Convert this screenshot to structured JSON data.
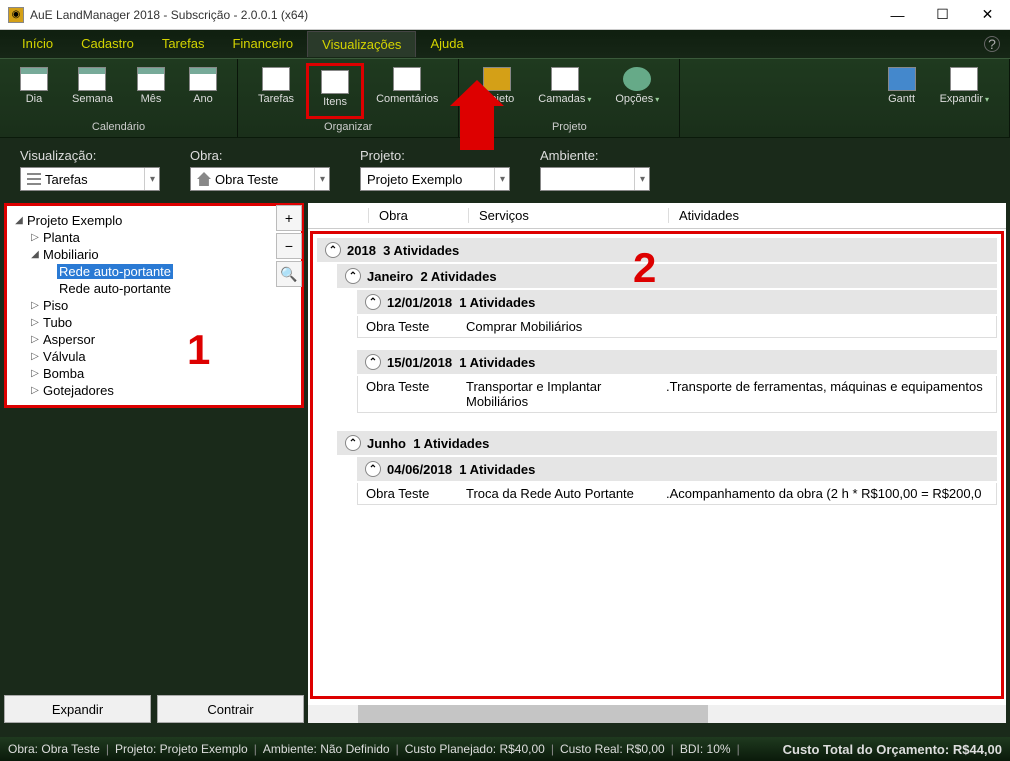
{
  "window": {
    "title": "AuE LandManager 2018  - Subscrição - 2.0.0.1 (x64)"
  },
  "menu": {
    "items": [
      "Início",
      "Cadastro",
      "Tarefas",
      "Financeiro",
      "Visualizações",
      "Ajuda"
    ],
    "active_index": 4
  },
  "ribbon": {
    "groups": [
      {
        "label": "Calendário",
        "buttons": [
          {
            "name": "dia",
            "label": "Dia"
          },
          {
            "name": "semana",
            "label": "Semana"
          },
          {
            "name": "mes",
            "label": "Mês"
          },
          {
            "name": "ano",
            "label": "Ano"
          }
        ]
      },
      {
        "label": "Organizar",
        "buttons": [
          {
            "name": "tarefas",
            "label": "Tarefas"
          },
          {
            "name": "itens",
            "label": "Itens",
            "highlight": true
          },
          {
            "name": "comentarios",
            "label": "Comentários"
          }
        ]
      },
      {
        "label": "Projeto",
        "buttons": [
          {
            "name": "projeto",
            "label": "Projeto"
          },
          {
            "name": "camadas",
            "label": "Camadas",
            "expand": true
          },
          {
            "name": "opcoes",
            "label": "Opções",
            "expand": true
          }
        ]
      },
      {
        "label": "",
        "buttons": [
          {
            "name": "gantt",
            "label": "Gantt"
          },
          {
            "name": "expandir",
            "label": "Expandir",
            "expand": true
          }
        ]
      }
    ]
  },
  "dropdowns": {
    "visualizacao": {
      "label": "Visualização:",
      "value": "Tarefas"
    },
    "obra": {
      "label": "Obra:",
      "value": "Obra Teste"
    },
    "projeto": {
      "label": "Projeto:",
      "value": "Projeto Exemplo"
    },
    "ambiente": {
      "label": "Ambiente:",
      "value": ""
    }
  },
  "tree": {
    "root": "Projeto Exemplo",
    "nodes": [
      {
        "label": "Planta",
        "expanded": false,
        "level": 1
      },
      {
        "label": "Mobiliario",
        "expanded": true,
        "level": 1
      },
      {
        "label": "Rede auto-portante",
        "level": 2,
        "selected": true
      },
      {
        "label": "Rede auto-portante",
        "level": 2
      },
      {
        "label": "Piso",
        "expanded": false,
        "level": 1
      },
      {
        "label": "Tubo",
        "expanded": false,
        "level": 1
      },
      {
        "label": "Aspersor",
        "expanded": false,
        "level": 1
      },
      {
        "label": "Válvula",
        "expanded": false,
        "level": 1
      },
      {
        "label": "Bomba",
        "expanded": false,
        "level": 1
      },
      {
        "label": "Gotejadores",
        "expanded": false,
        "level": 1
      }
    ],
    "annotation": "1",
    "buttons": {
      "expandir": "Expandir",
      "contrair": "Contrair"
    },
    "side": [
      "+",
      "−",
      "🔍"
    ]
  },
  "grid": {
    "headers": [
      "Obra",
      "Serviços",
      "Atividades"
    ],
    "annotation": "2",
    "year": {
      "label": "2018",
      "count": "3 Atividades"
    },
    "months": [
      {
        "label": "Janeiro",
        "count": "2 Atividades",
        "days": [
          {
            "date": "12/01/2018",
            "count": "1 Atividades",
            "rows": [
              {
                "obra": "Obra Teste",
                "servico": "Comprar Mobiliários",
                "atividade": ""
              }
            ]
          },
          {
            "date": "15/01/2018",
            "count": "1 Atividades",
            "rows": [
              {
                "obra": "Obra Teste",
                "servico": "Transportar e Implantar Mobiliários",
                "atividade": ".Transporte de ferramentas, máquinas e equipamentos"
              }
            ]
          }
        ]
      },
      {
        "label": "Junho",
        "count": "1 Atividades",
        "days": [
          {
            "date": "04/06/2018",
            "count": "1 Atividades",
            "rows": [
              {
                "obra": "Obra Teste",
                "servico": "Troca da Rede Auto Portante",
                "atividade": ".Acompanhamento da obra (2 h * R$100,00 = R$200,0"
              }
            ]
          }
        ]
      }
    ]
  },
  "statusbar": {
    "obra_label": "Obra:",
    "obra": "Obra Teste",
    "projeto_label": "Projeto:",
    "projeto": "Projeto Exemplo",
    "ambiente_label": "Ambiente:",
    "ambiente": "Não Definido",
    "custo_plan_label": "Custo Planejado:",
    "custo_plan": "R$40,00",
    "custo_real_label": "Custo Real:",
    "custo_real": "R$0,00",
    "bdi_label": "BDI:",
    "bdi": "10%",
    "total_label": "Custo Total do Orçamento:",
    "total": "R$44,00"
  }
}
